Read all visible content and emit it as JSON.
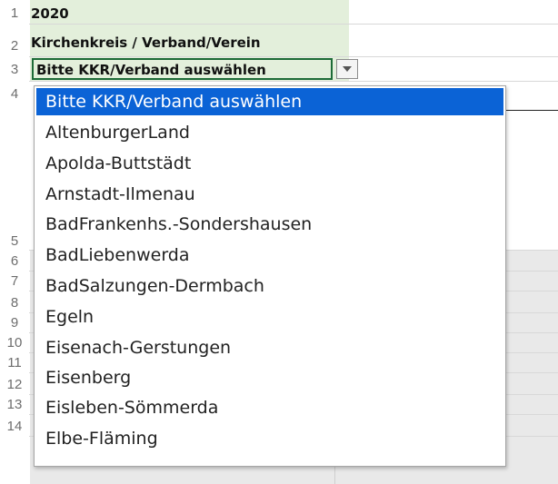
{
  "sheet": {
    "row_numbers": [
      "1",
      "2",
      "3",
      "4",
      "5",
      "6",
      "7",
      "8",
      "9",
      "10",
      "11",
      "12",
      "13",
      "14"
    ],
    "cells": {
      "a1": "2020",
      "a2": "Kirchenkreis / Verband/Verein",
      "a3": "Bitte KKR/Verband auswählen"
    },
    "colors": {
      "green_fill": "#e3efdb",
      "active_border": "#1d6b37",
      "grid": "#d8d8d8"
    }
  },
  "dropdown": {
    "button_icon": "chevron-down-icon",
    "selected": "Bitte KKR/Verband auswählen",
    "selection_color": "#0b63d6",
    "options": [
      "Bitte KKR/Verband auswählen",
      "AltenburgerLand",
      "Apolda-Buttstädt",
      "Arnstadt-Ilmenau",
      "BadFrankenhs.-Sondershausen",
      "BadLiebenwerda",
      "BadSalzungen-Dermbach",
      "Egeln",
      "Eisenach-Gerstungen",
      "Eisenberg",
      "Eisleben-Sömmerda",
      "Elbe-Fläming"
    ]
  }
}
